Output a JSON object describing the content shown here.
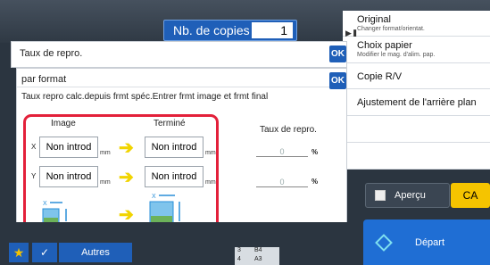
{
  "header": {
    "copies_label": "Nb. de copies",
    "copies_value": "1"
  },
  "right_panel": {
    "items": [
      {
        "title": "Original",
        "subtitle": "Changer format/orientat."
      },
      {
        "title": "Choix papier",
        "subtitle": "Modifier le mag. d'alim. pap."
      },
      {
        "title": "Copie R/V",
        "subtitle": ""
      },
      {
        "title": "Ajustement de l'arrière plan",
        "subtitle": ""
      }
    ],
    "apercu_label": "Aperçu",
    "ca_label": "CA",
    "depart_label": "Départ"
  },
  "dialog_outer": {
    "title": "Taux de repro.",
    "ok_label": "OK"
  },
  "dialog_inner": {
    "title": "par format",
    "ok_label": "OK",
    "description": "Taux repro calc.depuis frmt spéc.Entrer frmt image et frmt final"
  },
  "size_entry": {
    "image_header": "Image",
    "termine_header": "Terminé",
    "x_label": "X",
    "y_label": "Y",
    "unit": "mm",
    "image_x": "Non introd",
    "image_y": "Non introd",
    "termine_x": "Non introd",
    "termine_y": "Non introd"
  },
  "ratio": {
    "label": "Taux de repro.",
    "x_value": "0",
    "y_value": "0",
    "unit": "%"
  },
  "bottom_bar": {
    "autres_label": "Autres",
    "trays": [
      {
        "num": "3",
        "size": "B4"
      },
      {
        "num": "4",
        "size": "A3"
      }
    ]
  },
  "colors": {
    "accent_blue": "#1f5fb8",
    "highlight_red": "#e3203a",
    "arrow_yellow": "#f1d400",
    "ca_yellow": "#f5c400"
  }
}
